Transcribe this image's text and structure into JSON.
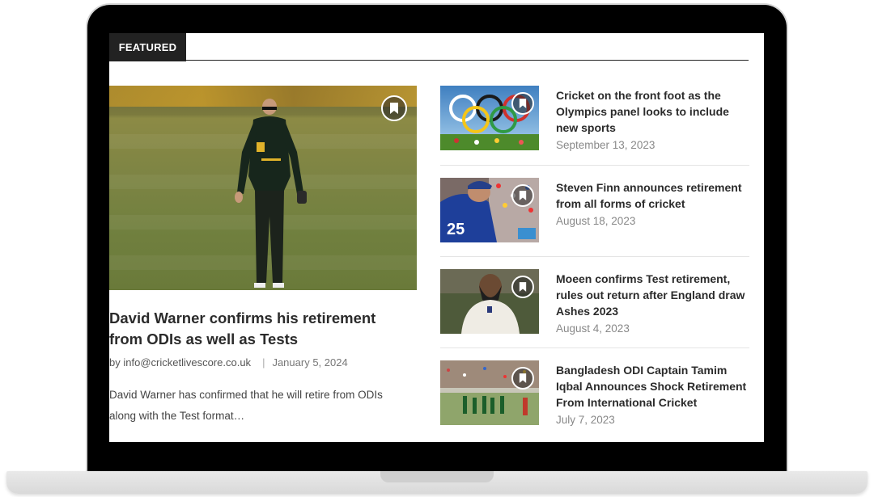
{
  "section": {
    "tab_label": "FEATURED"
  },
  "featured": {
    "title": "David Warner confirms his retirement from ODIs as well as Tests",
    "author_prefix": "by",
    "author": "info@cricketlivescore.co.uk",
    "separator": "|",
    "date": "January 5, 2024",
    "excerpt": "David Warner has confirmed that he will retire from ODIs along with the Test format…",
    "icon": "bookmark-icon"
  },
  "side_posts": [
    {
      "title": "Cricket on the front foot as the Olympics panel looks to include new sports",
      "date": "September 13, 2023",
      "icon": "bookmark-icon"
    },
    {
      "title": "Steven Finn announces retirement from all forms of cricket",
      "date": "August 18, 2023",
      "icon": "bookmark-icon"
    },
    {
      "title": "Moeen confirms Test retirement, rules out return after England draw Ashes 2023",
      "date": "August 4, 2023",
      "icon": "bookmark-icon"
    },
    {
      "title": "Bangladesh ODI Captain Tamim Iqbal Announces Shock Retirement From International Cricket",
      "date": "July 7, 2023",
      "icon": "bookmark-icon"
    }
  ],
  "colors": {
    "frame": "#000000",
    "tab_bg": "#222222",
    "text": "#2b2b2b",
    "date": "#888888"
  }
}
